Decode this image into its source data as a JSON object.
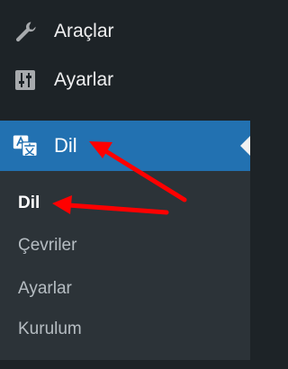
{
  "menu": {
    "items": [
      {
        "label": "Araçlar",
        "icon": "wrench-icon"
      },
      {
        "label": "Ayarlar",
        "icon": "sliders-icon"
      },
      {
        "label": "Dil",
        "icon": "translation-icon",
        "active": true
      }
    ],
    "submenu": [
      {
        "label": "Dil",
        "current": true
      },
      {
        "label": "Çevriler"
      },
      {
        "label": "Ayarlar"
      },
      {
        "label": "Kurulum"
      }
    ]
  },
  "colors": {
    "sidebar_bg": "#1d2327",
    "submenu_bg": "#2c3338",
    "active_bg": "#2271b1",
    "annotation_arrow": "#ff0000"
  }
}
